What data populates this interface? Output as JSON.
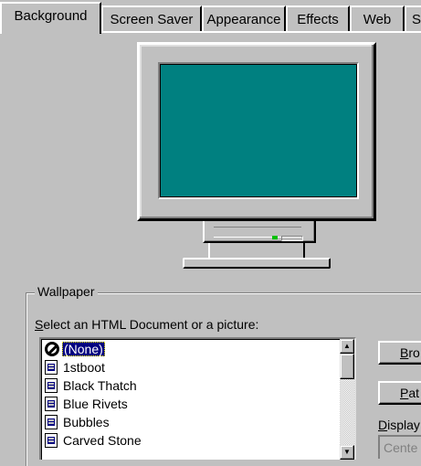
{
  "tabs": [
    {
      "label": "Background",
      "active": true
    },
    {
      "label": "Screen Saver",
      "active": false
    },
    {
      "label": "Appearance",
      "active": false
    },
    {
      "label": "Effects",
      "active": false
    },
    {
      "label": "Web",
      "active": false
    },
    {
      "label": "S",
      "active": false
    }
  ],
  "preview": {
    "screen_color": "#008080"
  },
  "wallpaper": {
    "group_title": "Wallpaper",
    "select_label_accel": "S",
    "select_label_rest": "elect an HTML Document or a picture:",
    "items": [
      {
        "label": "(None)",
        "icon": "none-icon",
        "selected": true
      },
      {
        "label": "1stboot",
        "icon": "document-icon",
        "selected": false
      },
      {
        "label": "Black Thatch",
        "icon": "document-icon",
        "selected": false
      },
      {
        "label": "Blue Rivets",
        "icon": "document-icon",
        "selected": false
      },
      {
        "label": "Bubbles",
        "icon": "document-icon",
        "selected": false
      },
      {
        "label": "Carved Stone",
        "icon": "document-icon",
        "selected": false
      }
    ],
    "browse_accel": "B",
    "browse_rest": "ro",
    "pattern_accel": "P",
    "pattern_rest": "at",
    "display_accel": "D",
    "display_rest": "isplay",
    "display_value": "Cente"
  }
}
